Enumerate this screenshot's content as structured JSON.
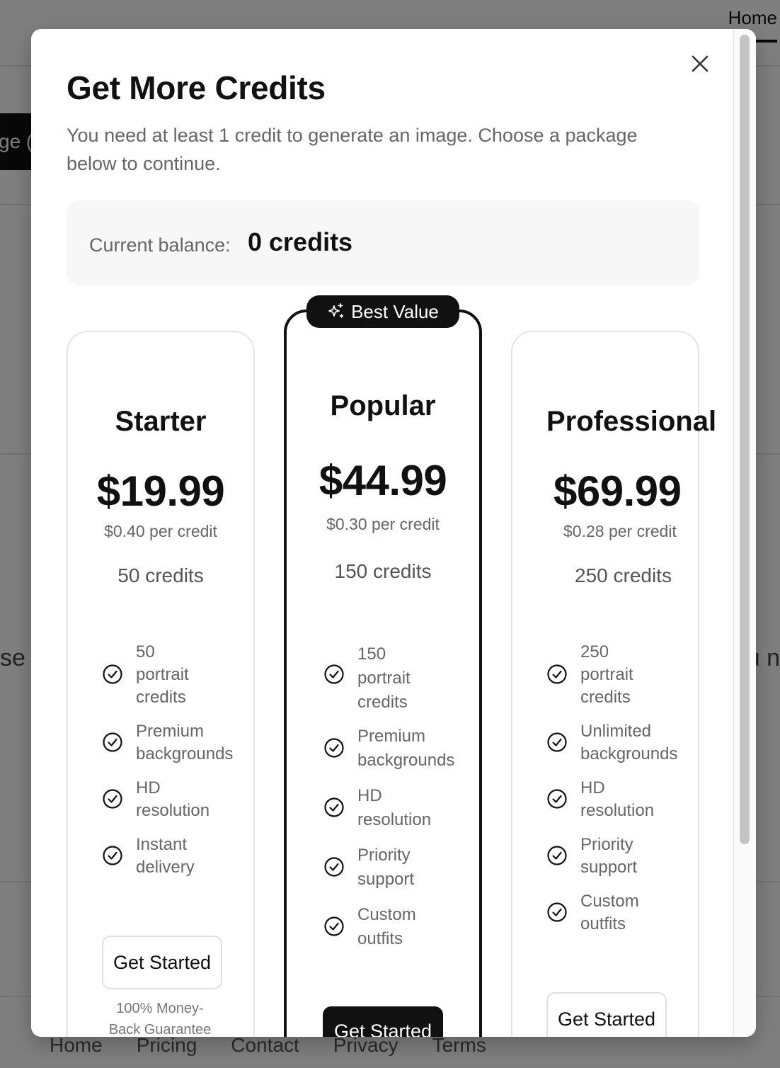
{
  "background": {
    "nav_home": "Home",
    "dark_button_fragment": "ge (",
    "left_fragment": "se a",
    "right_fragment": "u n",
    "footer_links": [
      "Home",
      "Pricing",
      "Contact",
      "Privacy",
      "Terms"
    ]
  },
  "modal": {
    "title": "Get More Credits",
    "subtitle": "You need at least 1 credit to generate an image. Choose a package below to continue.",
    "balance_label": "Current balance:",
    "balance_value": "0 credits",
    "badge_label": "Best Value",
    "plans": [
      {
        "name": "Starter",
        "price": "$19.99",
        "per_credit": "$0.40 per credit",
        "credits": "50 credits",
        "features": [
          [
            "50",
            "portrait",
            "credits"
          ],
          [
            "Premium",
            "backgrounds"
          ],
          [
            "HD",
            "resolution"
          ],
          [
            "Instant",
            "delivery"
          ]
        ],
        "button": "Get Started",
        "guarantee": [
          "100% Money-",
          "Back Guarantee"
        ]
      },
      {
        "name": "Popular",
        "price": "$44.99",
        "per_credit": "$0.30 per credit",
        "credits": "150 credits",
        "features": [
          [
            "150",
            "portrait",
            "credits"
          ],
          [
            "Premium",
            "backgrounds"
          ],
          [
            "HD",
            "resolution"
          ],
          [
            "Priority",
            "support"
          ],
          [
            "Custom",
            "outfits"
          ]
        ],
        "button": "Get Started"
      },
      {
        "name": "Professional",
        "price": "$69.99",
        "per_credit": "$0.28 per credit",
        "credits": "250 credits",
        "features": [
          [
            "250",
            "portrait",
            "credits"
          ],
          [
            "Unlimited",
            "backgrounds"
          ],
          [
            "HD",
            "resolution"
          ],
          [
            "Priority",
            "support"
          ],
          [
            "Custom",
            "outfits"
          ]
        ],
        "button": "Get Started"
      }
    ]
  }
}
